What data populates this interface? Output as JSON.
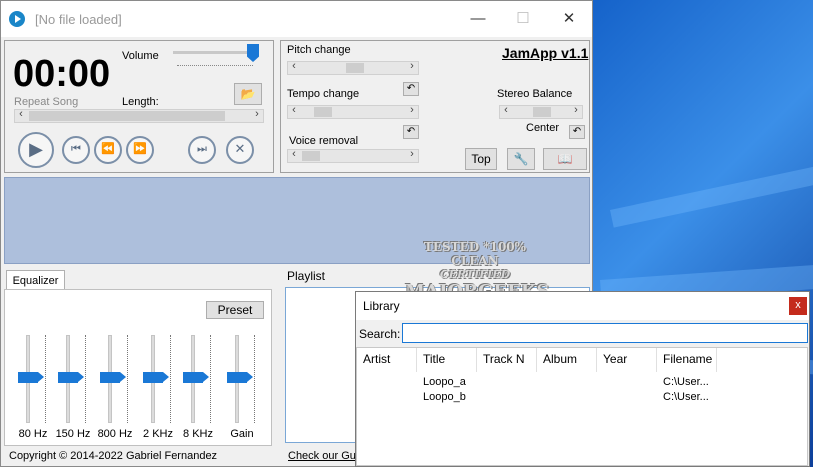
{
  "app": {
    "title": "[No file loaded]",
    "minimize": "—",
    "maximize": "☐",
    "close": "✕"
  },
  "player": {
    "time": "00:00",
    "volume_label": "Volume",
    "repeat": "Repeat Song",
    "length_label": "Length:"
  },
  "controls": {
    "pitch": "Pitch change",
    "tempo": "Tempo change",
    "voice": "Voice removal",
    "brand": "JamApp v1.1",
    "stereo": "Stereo Balance",
    "center": "Center",
    "top": "Top"
  },
  "equalizer": {
    "tab": "Equalizer",
    "preset": "Preset",
    "bands": [
      "80 Hz",
      "150 Hz",
      "800 Hz",
      "2 KHz",
      "8 KHz",
      "Gain"
    ]
  },
  "playlist": {
    "title": "Playlist"
  },
  "footer": {
    "copyright": "Copyright © 2014-2022 Gabriel Fernandez",
    "link": "Check our Gui"
  },
  "library": {
    "title": "Library",
    "close": "x",
    "search_label": "Search:",
    "search_value": "",
    "columns": [
      "Artist",
      "Title",
      "Track N",
      "Album",
      "Year",
      "Filename"
    ],
    "rows": [
      {
        "title": "Loopo_a",
        "filename": "C:\\User..."
      },
      {
        "title": "Loopo_b",
        "filename": "C:\\User..."
      }
    ]
  },
  "watermark": {
    "line1": "TESTED *100% CLEAN",
    "line2": "CERTIFIED",
    "line3": "MAJORGEEKS",
    ".com": ".COM"
  }
}
